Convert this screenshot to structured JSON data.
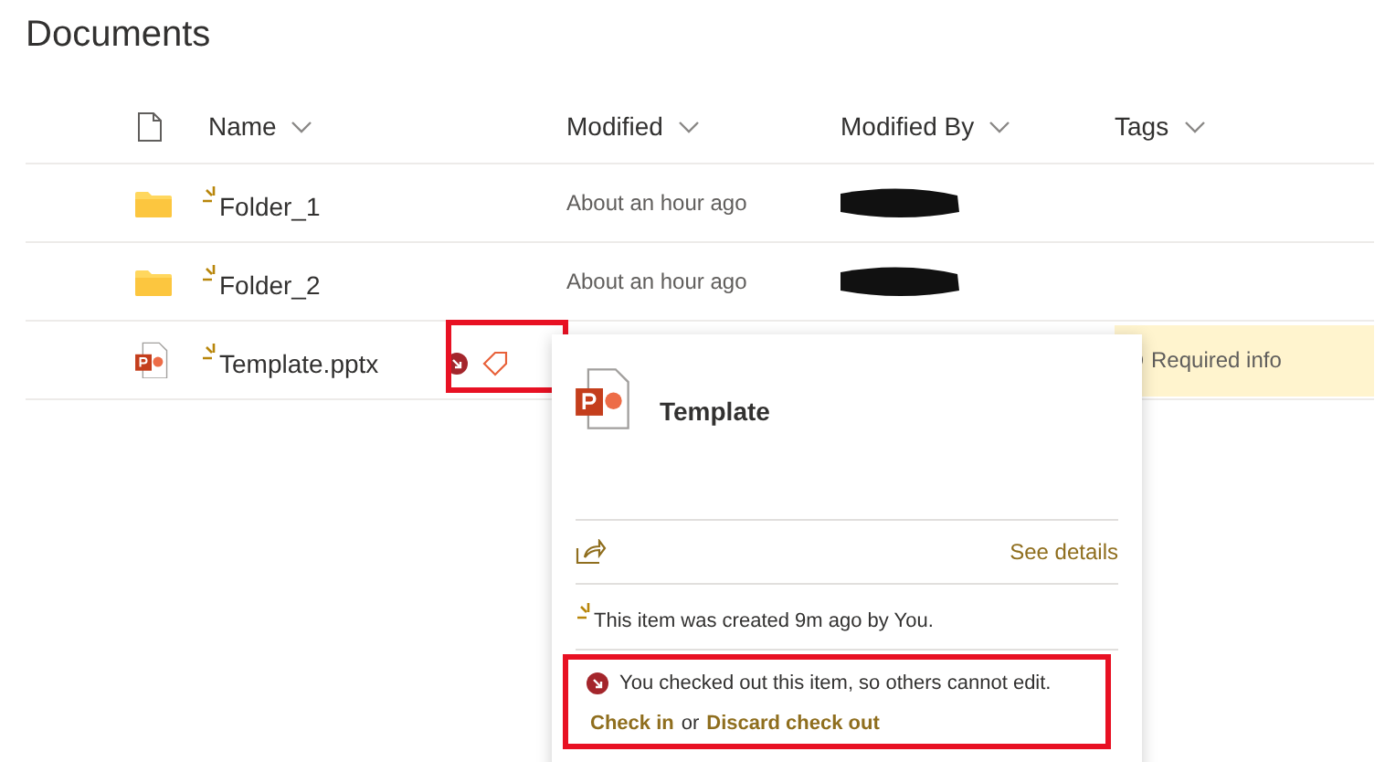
{
  "title": "Documents",
  "columns": [
    {
      "label": "Name"
    },
    {
      "label": "Modified"
    },
    {
      "label": "Modified By"
    },
    {
      "label": "Tags"
    }
  ],
  "rows": [
    {
      "kind": "folder",
      "name": "Folder_1",
      "new": true,
      "modified": "About an hour ago",
      "modified_by_redacted": true
    },
    {
      "kind": "folder",
      "name": "Folder_2",
      "new": true,
      "modified": "About an hour ago",
      "modified_by_redacted": true
    },
    {
      "kind": "pptx",
      "name": "Template.pptx",
      "new": true,
      "checked_out": true,
      "missing_tags": true,
      "tags": "Required info"
    }
  ],
  "popup": {
    "title": "Template",
    "see_details": "See details",
    "created": "This item was created 9m ago by You.",
    "checkout_message": "You checked out this item, so others cannot edit.",
    "check_in": "Check in",
    "or": "or",
    "discard": "Discard check out"
  }
}
